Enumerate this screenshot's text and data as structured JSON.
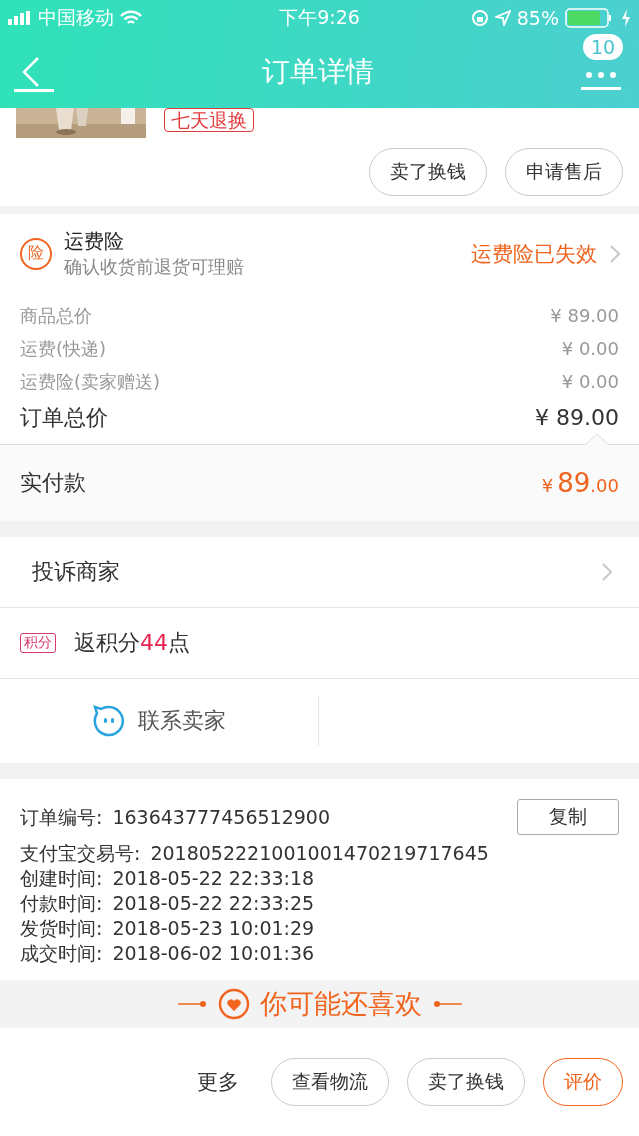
{
  "status_bar": {
    "carrier": "中国移动",
    "time": "下午9:26",
    "battery": "85%"
  },
  "nav": {
    "title": "订单详情",
    "badge": "10"
  },
  "product": {
    "tag": "七天退换"
  },
  "item_actions": [
    "卖了换钱",
    "申请售后"
  ],
  "insurance": {
    "icon": "险",
    "title": "运费险",
    "subtitle": "确认收货前退货可理赔",
    "status": "运费险已失效"
  },
  "prices": [
    {
      "label": "商品总价",
      "value": "¥ 89.00",
      "kind": "minor"
    },
    {
      "label": "运费(快递)",
      "value": "¥ 0.00",
      "kind": "minor"
    },
    {
      "label": "运费险(卖家赠送)",
      "value": "¥ 0.00",
      "kind": "minor"
    },
    {
      "label": "订单总价",
      "value": "¥ 89.00",
      "kind": "total"
    }
  ],
  "paid": {
    "label": "实付款",
    "currency": "¥",
    "amount": "89",
    "cents": ".00"
  },
  "complaint": "投诉商家",
  "points": {
    "badge": "积分",
    "text": "返积分**44**点"
  },
  "contact": "联系卖家",
  "order_info": {
    "copy": "复制",
    "lines": [
      {
        "label": "订单编号:",
        "value": "163643777456512900"
      },
      {
        "label": "支付宝交易号:",
        "value": "2018052221001001470219717645"
      },
      {
        "label": "创建时间:",
        "value": "2018-05-22 22:33:18"
      },
      {
        "label": "付款时间:",
        "value": "2018-05-22 22:33:25"
      },
      {
        "label": "发货时间:",
        "value": "2018-05-23 10:01:29"
      },
      {
        "label": "成交时间:",
        "value": "2018-06-02 10:01:36"
      }
    ]
  },
  "recommend": "你可能还喜欢",
  "bottom": {
    "more": "更多",
    "buttons": [
      {
        "label": "查看物流",
        "kind": "plain"
      },
      {
        "label": "卖了换钱",
        "kind": "plain"
      },
      {
        "label": "评价",
        "kind": "primary"
      }
    ]
  }
}
